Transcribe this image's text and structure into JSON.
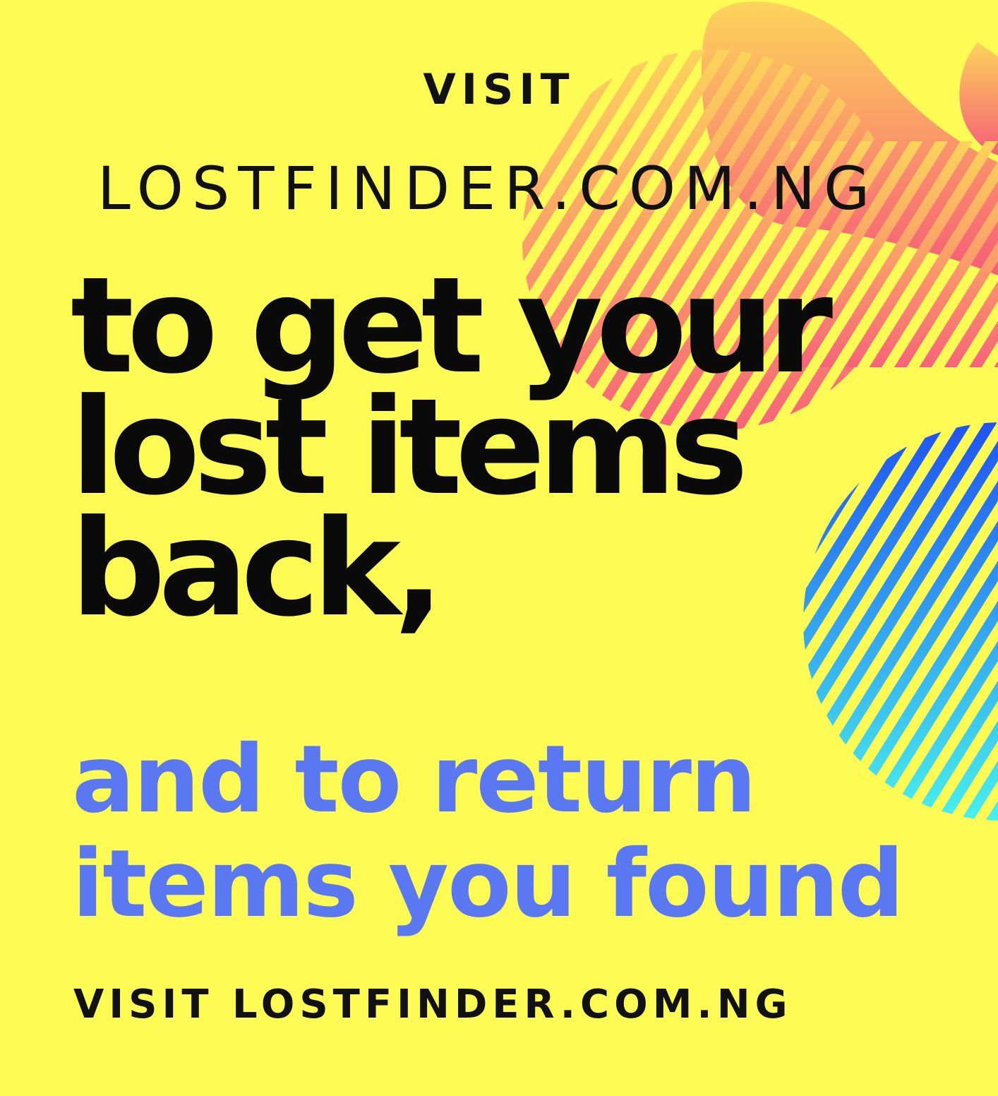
{
  "poster": {
    "visit_label": "VISIT",
    "site_name": "LOSTFINDER.COM.NG",
    "headline": [
      "to get your",
      "lost items",
      "back,"
    ],
    "subline": [
      "and to return",
      "items you found"
    ],
    "footer": "VISIT LOSTFINDER.COM.NG"
  },
  "colors": {
    "background": "#fefb55",
    "headline": "#0a0a0a",
    "subline": "#5b78f3",
    "blob_warm_top": "#fdd45a",
    "blob_warm_bottom": "#f7637a",
    "circle_blue_top": "#1f53f2",
    "circle_blue_bottom": "#47f0ee"
  },
  "icons": [
    "warm-gradient-blob-shape",
    "striped-warm-circle-shape",
    "striped-blue-circle-shape"
  ]
}
